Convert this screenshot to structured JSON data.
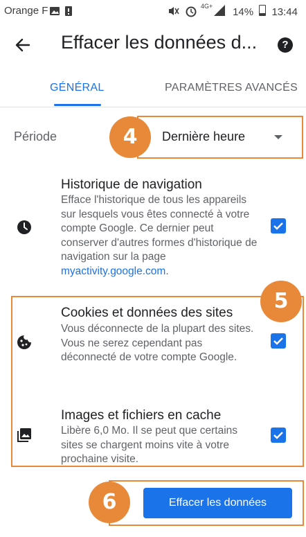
{
  "status_bar": {
    "carrier": "Orange F",
    "battery": "14%",
    "time": "13:44",
    "network": "4G+"
  },
  "header": {
    "title": "Effacer les données d...",
    "back_icon": "arrow-left-icon",
    "help_icon": "help-circle-icon",
    "help_glyph": "?"
  },
  "tabs": [
    {
      "label": "GÉNÉRAL",
      "active": true
    },
    {
      "label": "PARAMÈTRES AVANCÉS",
      "active": false
    }
  ],
  "period": {
    "label": "Période",
    "value": "Dernière heure"
  },
  "items": [
    {
      "icon": "clock-icon",
      "title": "Historique de navigation",
      "description": "Efface l'historique de tous les appareils sur lesquels vous êtes connecté à votre compte Google. Ce dernier peut conserver d'autres formes d'historique de navigation sur la page",
      "link": "myactivity.google.com",
      "link_suffix": ".",
      "checked": true
    },
    {
      "icon": "cookie-icon",
      "title": "Cookies et données des sites",
      "description": "Vous déconnecte de la plupart des sites. Vous ne serez cependant pas déconnecté de votre compte Google.",
      "checked": true
    },
    {
      "icon": "image-icon",
      "title": "Images et fichiers en cache",
      "description": "Libère 6,0 Mo. Il se peut que certains sites se chargent moins vite à votre prochaine visite.",
      "checked": true
    }
  ],
  "action": {
    "label": "Effacer les données"
  },
  "annotations": [
    "4",
    "5",
    "6"
  ],
  "colors": {
    "accent": "#1a73e8",
    "annotation": "#e8893a"
  }
}
